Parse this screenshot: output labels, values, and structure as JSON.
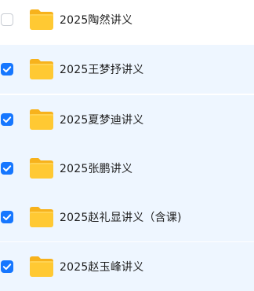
{
  "file_list": {
    "items": [
      {
        "name": "2025陶然讲义",
        "selected": false
      },
      {
        "name": "2025王梦抒讲义",
        "selected": true
      },
      {
        "name": "2025夏梦迪讲义",
        "selected": true
      },
      {
        "name": "2025张鹏讲义",
        "selected": true
      },
      {
        "name": "2025赵礼显讲义（含课)",
        "selected": true
      },
      {
        "name": "2025赵玉峰讲义",
        "selected": true
      }
    ],
    "icon": "folder-icon",
    "colors": {
      "selected_row_bg": "#eef6ff",
      "checkbox_checked": "#1677ff",
      "checkbox_unchecked_border": "#c9cdd4",
      "folder_body": "#ffc933",
      "folder_tab": "#f7b21c",
      "text": "#1f1f1f"
    }
  }
}
